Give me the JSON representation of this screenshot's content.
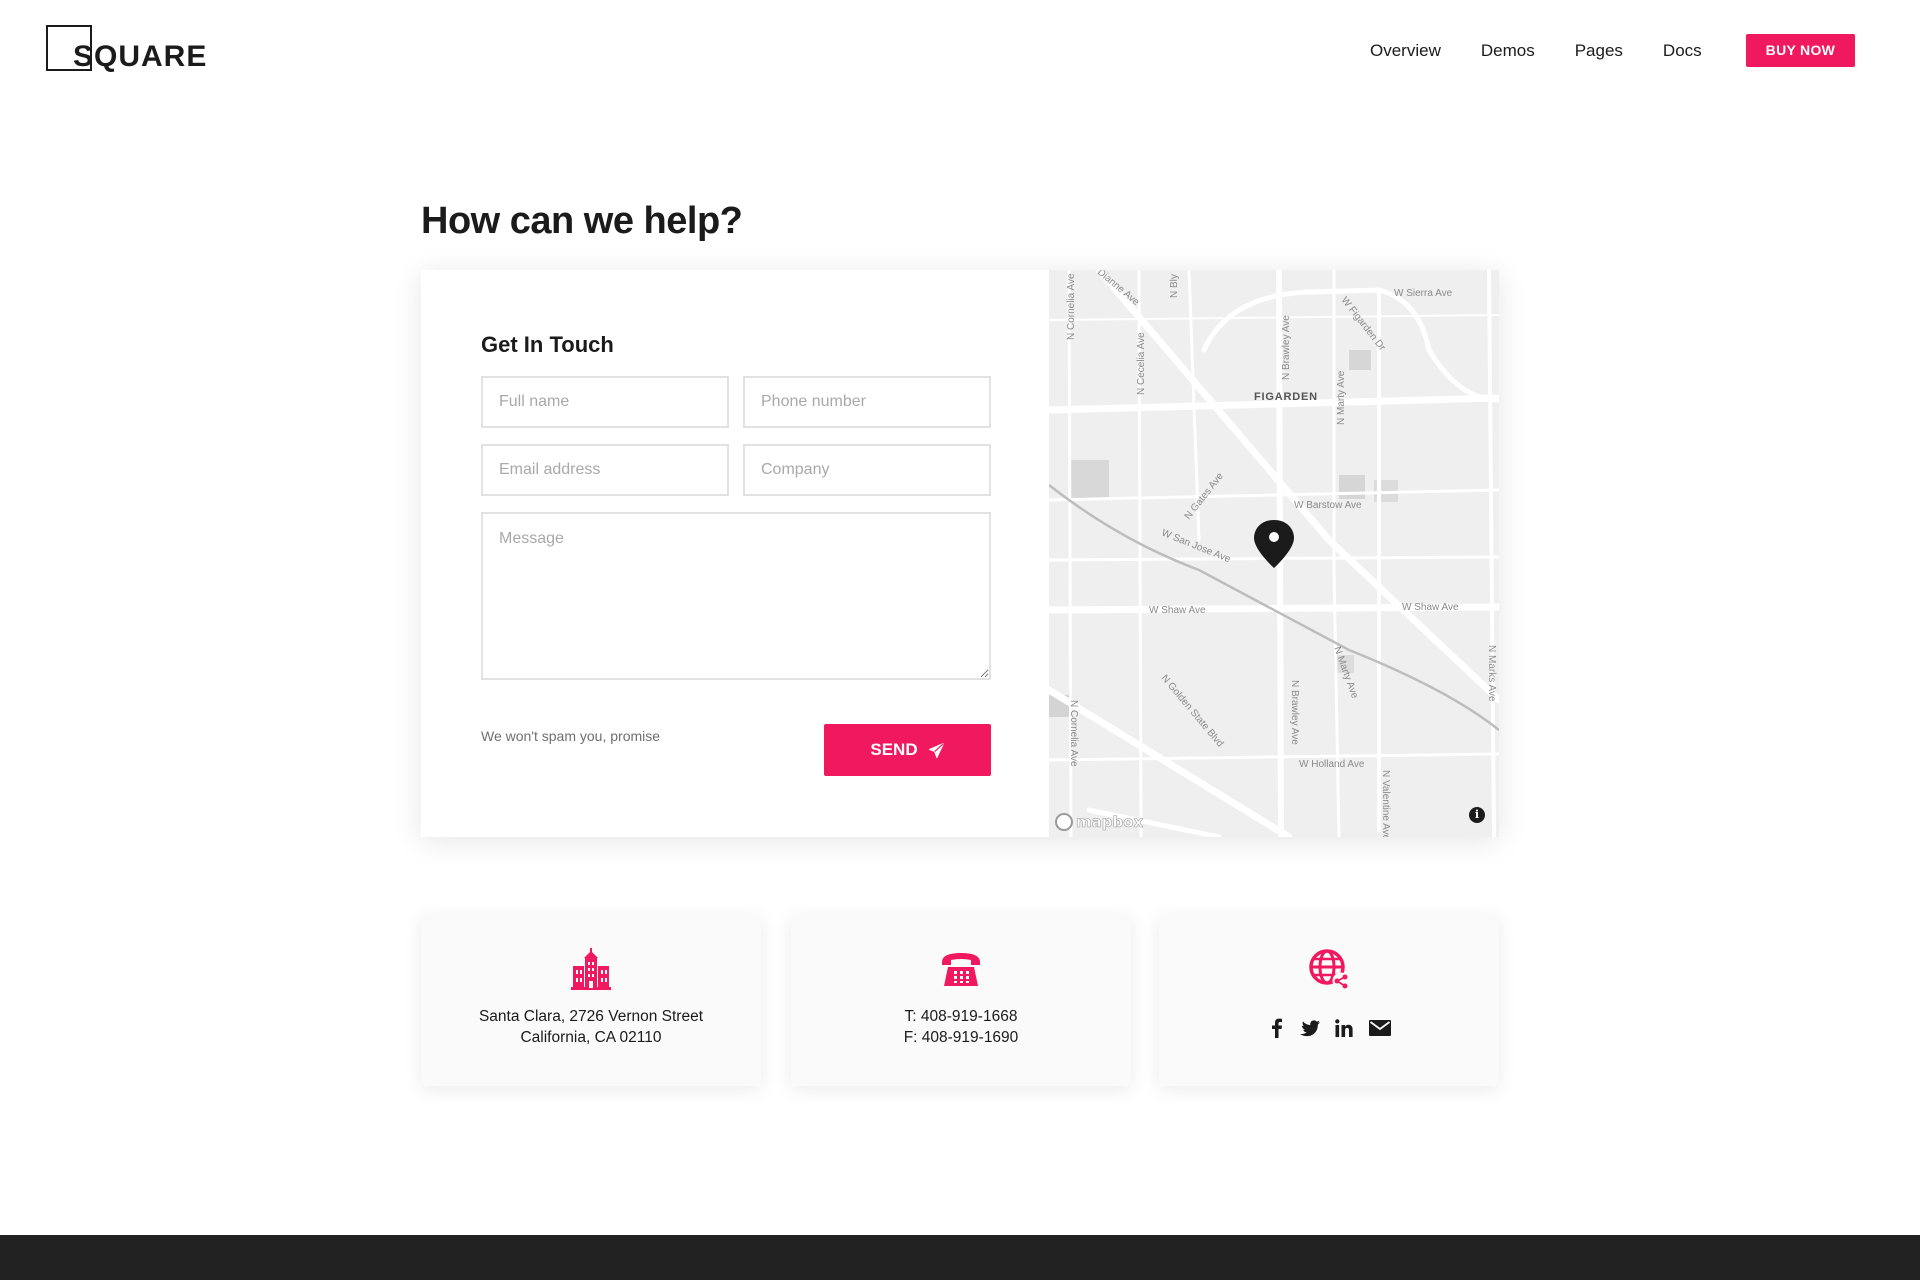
{
  "brand": {
    "logo_text": "SQUARE",
    "accent_color": "#f0185e"
  },
  "nav": {
    "items": [
      "Overview",
      "Demos",
      "Pages",
      "Docs"
    ],
    "cta_label": "BUY NOW"
  },
  "page": {
    "title": "How can we help?"
  },
  "contact_form": {
    "heading": "Get In Touch",
    "full_name_placeholder": "Full name",
    "phone_placeholder": "Phone number",
    "email_placeholder": "Email address",
    "company_placeholder": "Company",
    "message_placeholder": "Message",
    "spam_note": "We won't spam you, promise",
    "send_label": "SEND",
    "send_icon": "paper-plane-icon"
  },
  "map": {
    "provider_label": "mapbox",
    "neighborhood": "FIGARDEN",
    "streets": [
      "W Sierra Ave",
      "W Figarden Dr",
      "N Brawley Ave",
      "N Marty Ave",
      "N Cecelia Ave",
      "W Barstow Ave",
      "N Gates Ave",
      "W San Jose Ave",
      "W Shaw Ave",
      "N Golden State Blvd",
      "W Holland Ave",
      "N Valentine Ave",
      "N Marks Ave",
      "N Cornelia Ave",
      "N Bly",
      "Dianne Ave"
    ],
    "info_label": "i"
  },
  "info_cards": {
    "address": {
      "icon": "office-building-icon",
      "line1": "Santa Clara, 2726 Vernon Street",
      "line2": "California, CA 02110"
    },
    "phone": {
      "icon": "telephone-icon",
      "line1": "T: 408-919-1668",
      "line2": "F: 408-919-1690"
    },
    "social": {
      "icon": "globe-network-icon",
      "links": [
        "facebook-icon",
        "twitter-icon",
        "linkedin-icon",
        "email-icon"
      ]
    }
  }
}
